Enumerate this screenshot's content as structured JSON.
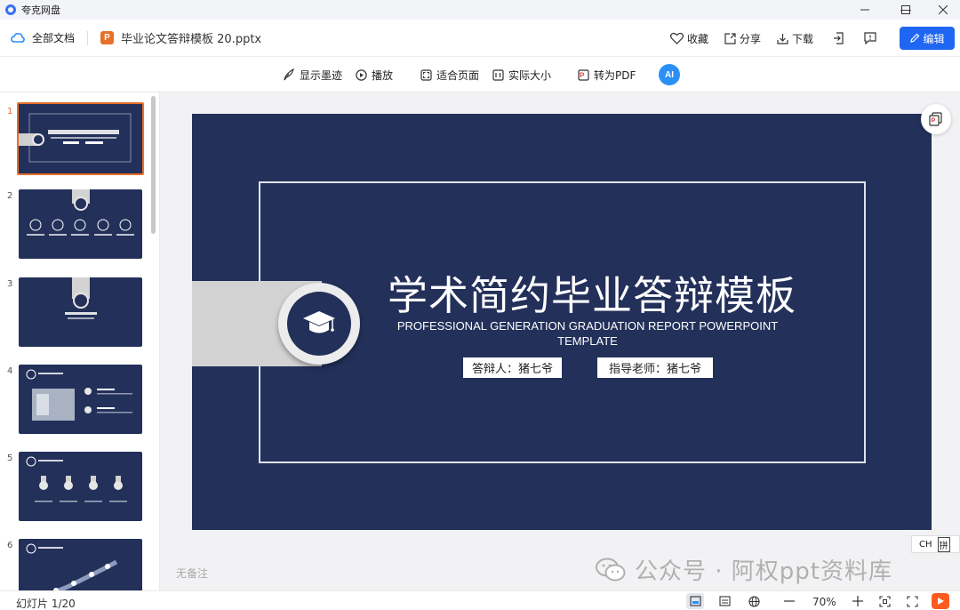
{
  "app": {
    "title": "夸克网盘"
  },
  "window": {
    "minimize_icon": "minimize-icon",
    "maximize_icon": "maximize-icon",
    "close_icon": "close-icon"
  },
  "header": {
    "all_docs": "全部文档",
    "file_icon_letter": "P",
    "filename": "毕业论文答辩模板 20.pptx",
    "favorite": "收藏",
    "share": "分享",
    "download": "下载",
    "edit": "编辑"
  },
  "toolbar": {
    "show_ink": "显示墨迹",
    "play": "播放",
    "fit_page": "适合页面",
    "actual_size": "实际大小",
    "to_pdf": "转为PDF",
    "ai_label": "AI"
  },
  "sidebar": {
    "slides": [
      {
        "num": "1",
        "active": true
      },
      {
        "num": "2",
        "active": false
      },
      {
        "num": "3",
        "active": false
      },
      {
        "num": "4",
        "active": false
      },
      {
        "num": "5",
        "active": false
      },
      {
        "num": "6",
        "active": false
      }
    ]
  },
  "slide": {
    "title": "学术简约毕业答辩模板",
    "subtitle": "PROFESSIONAL GENERATION GRADUATION REPORT POWERPOINT TEMPLATE",
    "presenter": "答辩人：猪七爷",
    "advisor": "指导老师：猪七爷",
    "colors": {
      "background": "#23305a",
      "frame": "#dfe3ec",
      "band": "#d2d2d2"
    }
  },
  "main": {
    "notes": "无备注"
  },
  "ime": {
    "lang": "CH",
    "mode": "拼"
  },
  "watermark": {
    "text": "公众号 · 阿权ppt资料库"
  },
  "status": {
    "slide_count": "幻灯片 1/20",
    "zoom": "70%"
  },
  "accent": {
    "edit_button": "#1f66f2",
    "ppt_icon": "#e8702a",
    "active_thumb_border": "#e8702a",
    "logo": "#3b6ff5"
  }
}
